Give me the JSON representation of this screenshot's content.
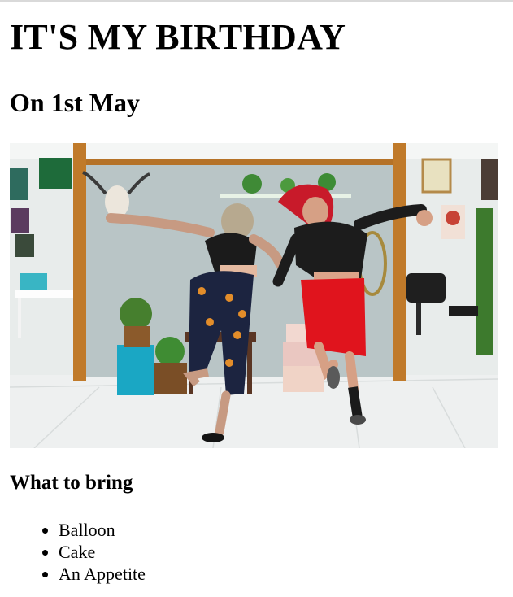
{
  "page": {
    "title": "IT'S MY BIRTHDAY",
    "subtitle": "On 1st May",
    "photo_icon": "dancing-photo",
    "section_heading": "What to bring",
    "items": [
      "Balloon",
      "Cake",
      "An Appetite"
    ]
  },
  "colors": {
    "text": "#000000",
    "background": "#ffffff",
    "divider": "#d9d9d9"
  }
}
